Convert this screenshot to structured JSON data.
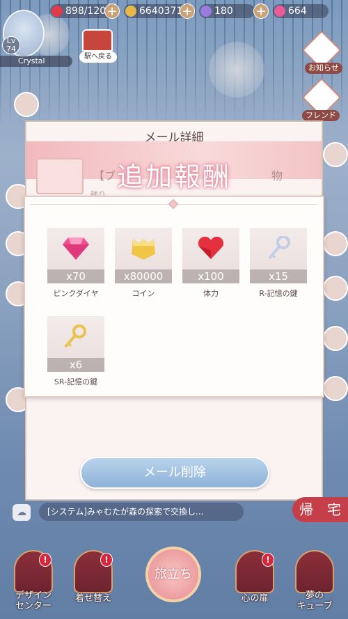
{
  "topbar": {
    "stamina": "898/120",
    "coins": "6640371",
    "gems_purple": "180",
    "gems_pink": "664",
    "plus": "+"
  },
  "player": {
    "level_prefix": "Lv",
    "level": "74",
    "name": "Crystal"
  },
  "station": {
    "label": "駅へ戻る"
  },
  "right_menu": {
    "news": "お知らせ",
    "friends": "フレンド"
  },
  "modal": {
    "title": "メール詳細",
    "banner_faded": "【ブ　　　　　　　　　　　　　　物",
    "banner_small": "残り",
    "reward_title": "追加報酬",
    "items": [
      {
        "qty": "x70",
        "name": "ピンクダイヤ"
      },
      {
        "qty": "x80000",
        "name": "コイン"
      },
      {
        "qty": "x100",
        "name": "体力"
      },
      {
        "qty": "x15",
        "name": "R-記憶の鍵"
      },
      {
        "qty": "x6",
        "name": "SR-記憶の鍵"
      }
    ],
    "delete_button": "メール削除"
  },
  "chat": {
    "text": "[システム]みゃむたが森の探索で交換し..."
  },
  "home_button": "帰　宅",
  "bottom_nav": {
    "design_center": "デザイン\nセンター",
    "dress_up": "着せ替え",
    "tabidachi": "旅立ち",
    "heart_door": "心の扉",
    "dream_cube": "夢の\nキューブ"
  },
  "colors": {
    "accent_pink": "#e58a9c",
    "delete_blue": "#8fb2d7",
    "home_red": "#c43f4a"
  }
}
